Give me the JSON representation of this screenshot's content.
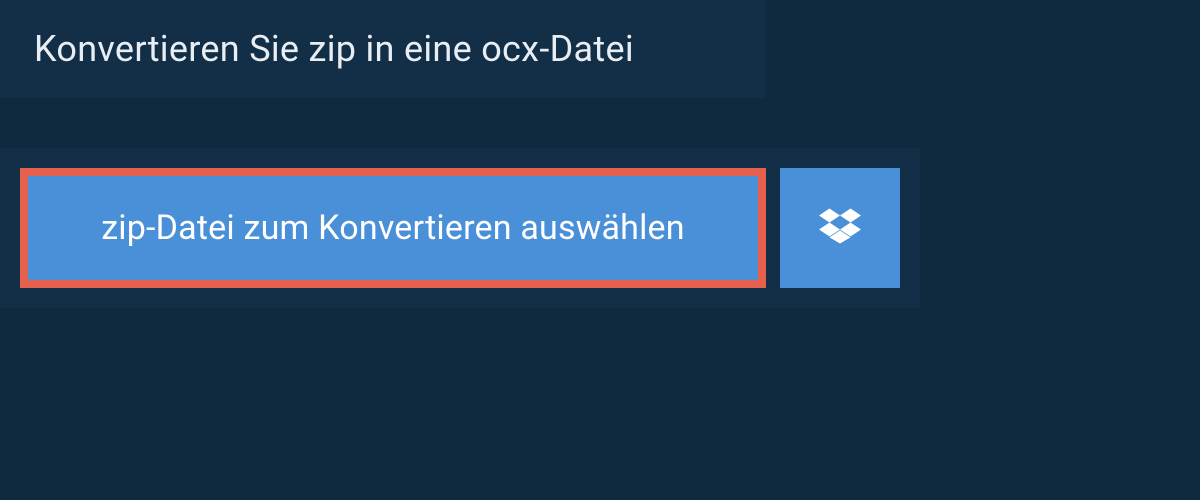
{
  "header": {
    "title": "Konvertieren Sie zip in eine ocx-Datei"
  },
  "buttons": {
    "select_file_label": "zip-Datei zum Konvertieren auswählen"
  }
}
